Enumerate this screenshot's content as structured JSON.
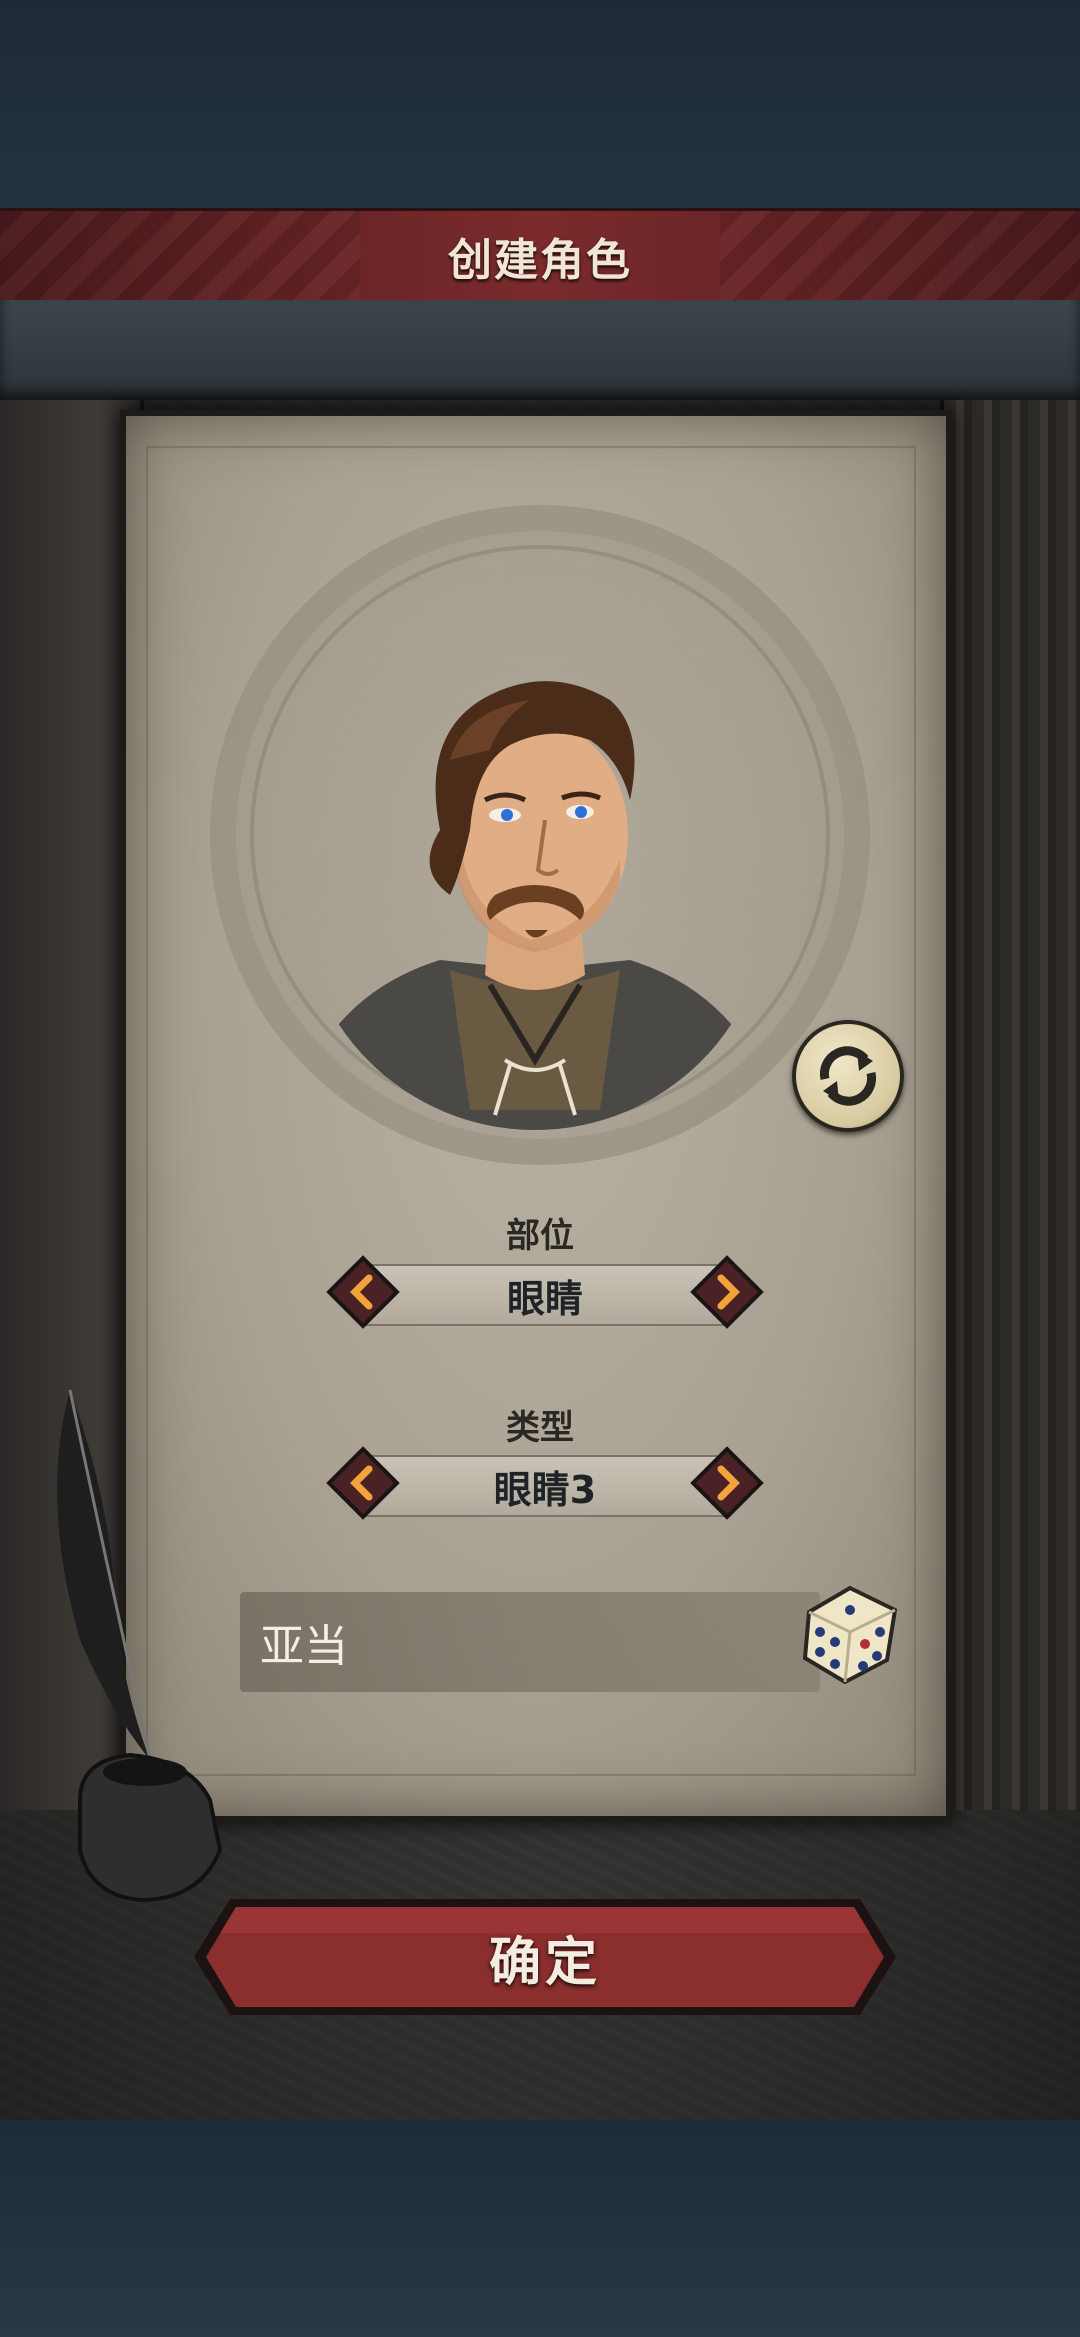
{
  "header": {
    "title": "创建角色"
  },
  "portrait": {
    "reroll_icon": "refresh-icon"
  },
  "part_selector": {
    "label": "部位",
    "value": "眼睛"
  },
  "type_selector": {
    "label": "类型",
    "value": "眼睛3"
  },
  "name_field": {
    "value": "亚当",
    "dice_icon": "dice-icon"
  },
  "confirm": {
    "label": "确定"
  },
  "colors": {
    "banner": "#7b2b2c",
    "arrow_accent": "#f2a43a",
    "parchment": "#b0a998"
  }
}
